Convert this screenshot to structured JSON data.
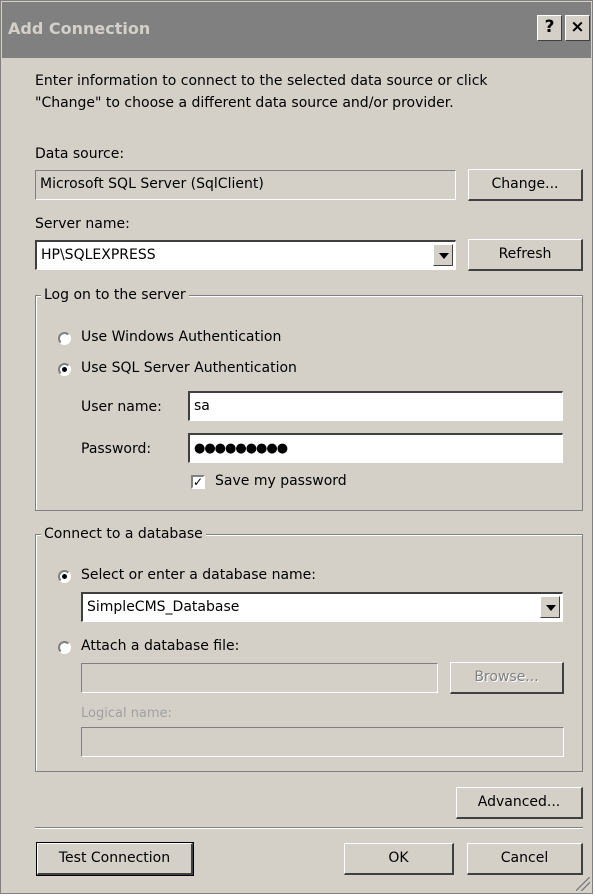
{
  "window": {
    "title": "Add Connection",
    "help_label": "?",
    "close_label": "×"
  },
  "intro": {
    "line1": "Enter information to connect to the selected data source or click",
    "line2": "\"Change\" to choose a different data source and/or provider."
  },
  "data_source": {
    "label": "Data source:",
    "value": "Microsoft SQL Server (SqlClient)",
    "change_label": "Change..."
  },
  "server": {
    "label": "Server name:",
    "value": "HP\\SQLEXPRESS",
    "refresh_label": "Refresh"
  },
  "logon": {
    "legend": "Log on to the server",
    "windows_auth_label": "Use Windows Authentication",
    "sql_auth_label": "Use SQL Server Authentication",
    "selected": "sql",
    "username_label": "User name:",
    "username_value": "sa",
    "password_label": "Password:",
    "password_value": "●●●●●●●●●",
    "save_password_label": "Save my password",
    "save_password_checked": true
  },
  "database": {
    "legend": "Connect to a database",
    "select_label": "Select or enter a database name:",
    "database_name": "SimpleCMS_Database",
    "attach_label": "Attach a database file:",
    "attach_value": "",
    "browse_label": "Browse...",
    "logical_name_label": "Logical name:",
    "logical_name_value": "",
    "selected": "select"
  },
  "buttons": {
    "advanced_label": "Advanced...",
    "test_label": "Test Connection",
    "ok_label": "OK",
    "cancel_label": "Cancel"
  },
  "colors": {
    "face": "#d4d0c8",
    "title_bar": "#808080"
  },
  "icons": {
    "dropdown": "chevron-down-icon",
    "resize": "resize-grip-icon"
  }
}
